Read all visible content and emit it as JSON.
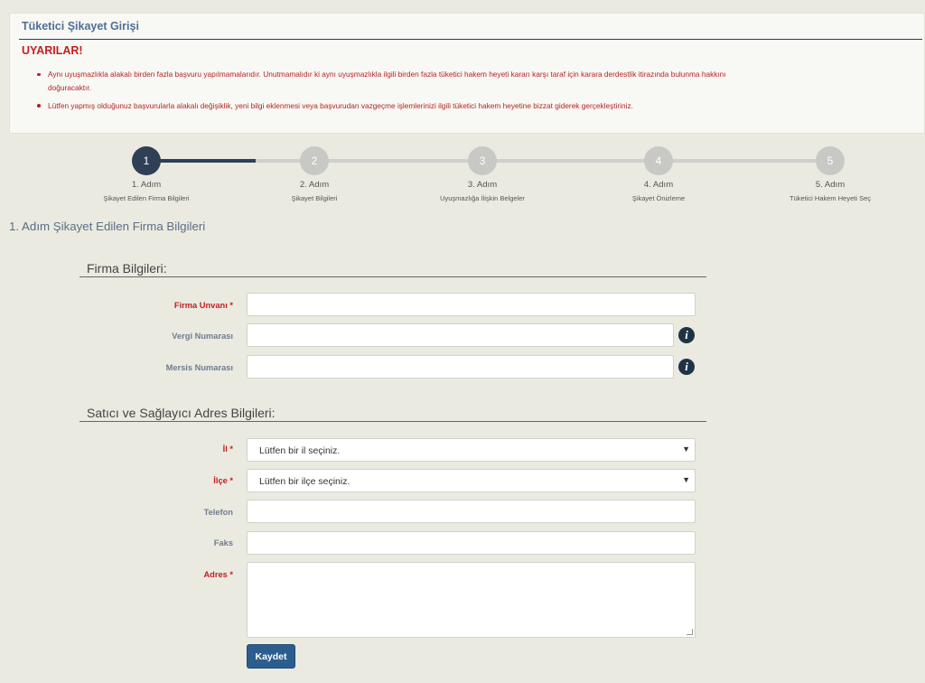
{
  "panel": {
    "title": "Tüketici Şikayet Girişi",
    "warnings_title": "UYARILAR!",
    "warnings": [
      "Aynı uyuşmazlıkla alakalı birden fazla başvuru yapılmamalarıdır. Unutmamalıdır ki aynı uyuşmazlıkla ilgili birden fazla tüketici hakem heyeti kararı karşı taraf için karara derdestlik itirazında bulunma hakkını doğuracaktır.",
      "Lütfen yapmış olduğunuz başvurularla alakalı değişiklik, yeni bilgi eklenmesi veya başvurudan vazgeçme işlemlerinizi ilgili tüketici hakem heyetine bizzat giderek gerçekleştiriniz."
    ]
  },
  "steps": [
    {
      "num": "1",
      "label": "1. Adım",
      "sub": "Şikayet Edilen Firma Bilgileri",
      "active": true
    },
    {
      "num": "2",
      "label": "2. Adım",
      "sub": "Şikayet Bilgileri",
      "active": false
    },
    {
      "num": "3",
      "label": "3. Adım",
      "sub": "Uyuşmazlığa İlişkin Belgeler",
      "active": false
    },
    {
      "num": "4",
      "label": "4. Adım",
      "sub": "Şikayet Önizleme",
      "active": false
    },
    {
      "num": "5",
      "label": "5. Adım",
      "sub": "Tüketici Hakem Heyeti Seç",
      "active": false
    }
  ],
  "section_title": "1. Adım Şikayet Edilen Firma Bilgileri",
  "firma": {
    "title": "Firma Bilgileri:",
    "unvan_label": "Firma Unvanı *",
    "unvan_value": "",
    "vergi_label": "Vergi Numarası",
    "vergi_value": "",
    "mersis_label": "Mersis Numarası",
    "mersis_value": ""
  },
  "adres": {
    "title": "Satıcı ve Sağlayıcı Adres Bilgileri:",
    "il_label": "İl *",
    "il_selected": "Lütfen bir il seçiniz.",
    "ilce_label": "İlçe *",
    "ilce_selected": "Lütfen bir ilçe seçiniz.",
    "telefon_label": "Telefon",
    "telefon_value": "",
    "faks_label": "Faks",
    "faks_value": "",
    "adres_label": "Adres *",
    "adres_value": ""
  },
  "icons": {
    "info": "info-icon",
    "caret": "chevron-down-icon",
    "info_glyph": "i",
    "caret_glyph": "▼"
  },
  "save_label": "Kaydet",
  "colors": {
    "active_step": "#2f4056",
    "inactive_step": "#c8c9c5",
    "required": "#c41e1e",
    "button": "#2c5d8f"
  }
}
